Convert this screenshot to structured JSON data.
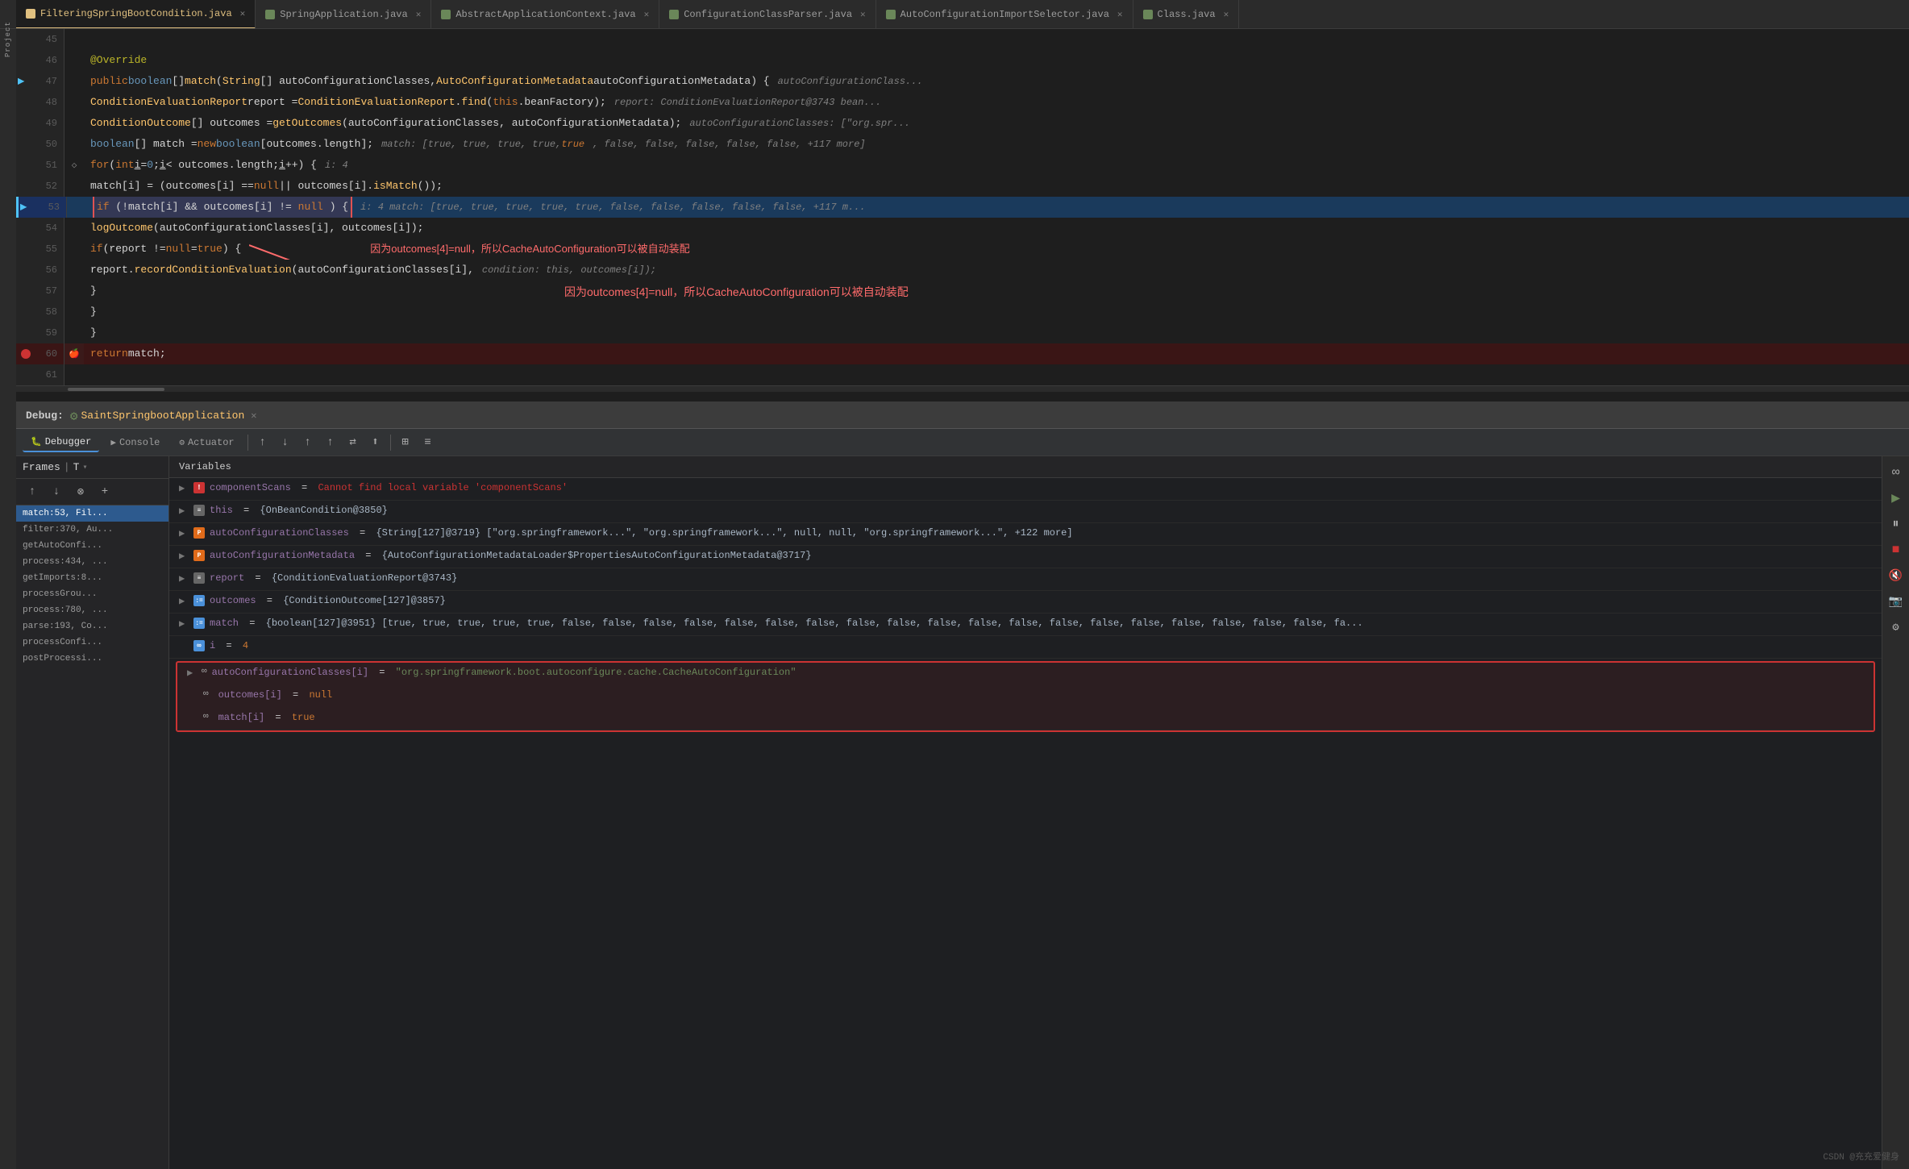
{
  "tabs": [
    {
      "label": "FilteringSpringBootCondition.java",
      "active": true,
      "color": "#e0c080"
    },
    {
      "label": "SpringApplication.java",
      "active": false
    },
    {
      "label": "AbstractApplicationContext.java",
      "active": false
    },
    {
      "label": "ConfigurationClassParser.java",
      "active": false
    },
    {
      "label": "AutoConfigurationImportSelector.java",
      "active": false
    },
    {
      "label": "Class.java",
      "active": false
    }
  ],
  "code_lines": [
    {
      "num": 45,
      "content": "",
      "type": "normal"
    },
    {
      "num": 46,
      "content": "    @Override",
      "type": "annotation"
    },
    {
      "num": 47,
      "content": "    public boolean[] match(String[] autoConfigurationClasses, AutoConfigurationMetadata autoConfigurationMetadata) {",
      "type": "normal",
      "inline": "autoConfigurationClass..."
    },
    {
      "num": 48,
      "content": "        ConditionEvaluationReport report = ConditionEvaluationReport.find(this.beanFactory);",
      "type": "normal",
      "inline": "report: ConditionEvaluationReport@3743   bean..."
    },
    {
      "num": 49,
      "content": "        ConditionOutcome[] outcomes = getOutcomes(autoConfigurationClasses, autoConfigurationMetadata);",
      "type": "normal",
      "inline": "autoConfigurationClasses: [\"org.spr..."
    },
    {
      "num": 50,
      "content": "        boolean[] match = new boolean[outcomes.length];",
      "type": "normal",
      "inline": "match: [true, true, true, true, true, false, false, false, false, false, +117 more]"
    },
    {
      "num": 51,
      "content": "        for (int i = 0; i < outcomes.length; i++) {",
      "type": "normal",
      "inline": "i: 4"
    },
    {
      "num": 52,
      "content": "            match[i] = (outcomes[i] == null || outcomes[i].isMatch());",
      "type": "normal"
    },
    {
      "num": 53,
      "content": "            if (!match[i] && outcomes[i] != null) {",
      "type": "highlighted",
      "inline": "i: 4    match: [true, true, true, true, true, false, false, false, false, false, +117 m..."
    },
    {
      "num": 54,
      "content": "                logOutcome(autoConfigurationClasses[i], outcomes[i]);",
      "type": "normal"
    },
    {
      "num": 55,
      "content": "                if (report != null = true ) {",
      "type": "normal"
    },
    {
      "num": 56,
      "content": "                    report.recordConditionEvaluation(autoConfigurationClasses[i],",
      "type": "normal",
      "inline": "condition: this, outcomes[i]);"
    },
    {
      "num": 57,
      "content": "                }",
      "type": "normal"
    },
    {
      "num": 58,
      "content": "            }",
      "type": "normal"
    },
    {
      "num": 59,
      "content": "        }",
      "type": "normal"
    },
    {
      "num": 60,
      "content": "        return match;",
      "type": "breakpoint"
    },
    {
      "num": 61,
      "content": "",
      "type": "normal"
    }
  ],
  "debug": {
    "title": "Debug:",
    "session_name": "SaintSpringbootApplication",
    "tabs": [
      "Debugger",
      "Console",
      "Actuator"
    ],
    "active_tab": "Debugger",
    "frames_label": "Frames",
    "thread_label": "T",
    "variables_label": "Variables",
    "frames": [
      {
        "label": "match:53, Fil...",
        "active": true
      },
      {
        "label": "filter:370, Au..."
      },
      {
        "label": "getAutoConfi..."
      },
      {
        "label": "process:434, ..."
      },
      {
        "label": "getImports:8..."
      },
      {
        "label": "processGrou..."
      },
      {
        "label": "process:780, ..."
      },
      {
        "label": "parse:193, Co..."
      },
      {
        "label": "processConfi..."
      },
      {
        "label": "postProcessi..."
      }
    ],
    "variables": [
      {
        "type": "error",
        "name": "componentScans",
        "eq": "=",
        "value": "Cannot find local variable 'componentScans'",
        "val_type": "error",
        "expandable": true
      },
      {
        "type": "list",
        "name": "this",
        "eq": "=",
        "value": "{OnBeanCondition@3850}",
        "val_type": "normal",
        "expandable": true
      },
      {
        "type": "orange",
        "name": "autoConfigurationClasses",
        "eq": "=",
        "value": "{String[127]@3719} [\"org.springframework...\", \"org.springframework...\", null, null, \"org.springframework...\", +122 more]",
        "val_type": "normal",
        "expandable": true
      },
      {
        "type": "orange",
        "name": "autoConfigurationMetadata",
        "eq": "=",
        "value": "{AutoConfigurationMetadataLoader$PropertiesAutoConfigurationMetadata@3717}",
        "val_type": "normal",
        "expandable": true
      },
      {
        "type": "list",
        "name": "report",
        "eq": "=",
        "value": "{ConditionEvaluationReport@3743}",
        "val_type": "normal",
        "expandable": true
      },
      {
        "type": "list2",
        "name": "outcomes",
        "eq": "=",
        "value": "{ConditionOutcome[127]@3857}",
        "val_type": "normal",
        "expandable": true
      },
      {
        "type": "list2",
        "name": "match",
        "eq": "=",
        "value": "{boolean[127]@3951} [true, true, true, true, true, false, false, false, false, false, false, false, false, false, false, false, false, false, false, false, false, false, false, false, fa...",
        "val_type": "normal",
        "expandable": true
      },
      {
        "type": "num",
        "name": "i",
        "eq": "=",
        "value": "4",
        "val_type": "num",
        "expandable": false
      },
      {
        "type": "string_obj",
        "name": "autoConfigurationClasses[i]",
        "eq": "=",
        "value": "\"org.springframework.boot.autoconfigure.cache.CacheAutoConfiguration\"",
        "val_type": "string",
        "expandable": true,
        "highlighted": true
      },
      {
        "type": "string_obj",
        "name": "outcomes[i]",
        "eq": "=",
        "value": "null",
        "val_type": "null",
        "expandable": false,
        "indent": true,
        "highlighted_var": true
      },
      {
        "type": "string_obj",
        "name": "match[i]",
        "eq": "=",
        "value": "true",
        "val_type": "bool",
        "expandable": false,
        "indent": true
      }
    ]
  },
  "watermark": "CSDN @充充爱健身",
  "cn_annotation": "因为outcomes[4]=null，所以CacheAutoConfiguration可以被自动装配"
}
